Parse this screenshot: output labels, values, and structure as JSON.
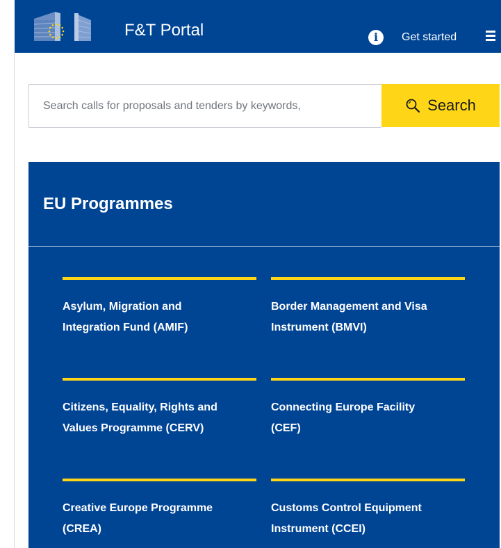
{
  "header": {
    "app_title": "F&T Portal",
    "info_glyph": "i",
    "get_started_label": "Get started",
    "logo_icon": "european-commission-logo-icon",
    "menu_icon": "hamburger-menu-icon"
  },
  "search": {
    "placeholder": "Search calls for proposals and tenders by keywords,",
    "button_label": "Search",
    "button_icon": "magnifier-icon"
  },
  "programmes": {
    "title": "EU Programmes",
    "items": [
      {
        "line1": "Asylum, Migration and",
        "line2": "Integration Fund (AMIF)"
      },
      {
        "line1": "Border Management and Visa",
        "line2": "Instrument (BMVI)"
      },
      {
        "line1": "Citizens, Equality, Rights and",
        "line2": "Values Programme (CERV)"
      },
      {
        "line1": "Connecting Europe Facility",
        "line2": "(CEF)"
      },
      {
        "line1": "Creative Europe Programme",
        "line2": "(CREA)"
      },
      {
        "line1": "Customs Control Equipment",
        "line2": "Instrument (CCEI)"
      }
    ]
  },
  "colors": {
    "primary_blue": "#004494",
    "accent_yellow": "#ffd617",
    "text_on_blue": "#ffffff"
  }
}
